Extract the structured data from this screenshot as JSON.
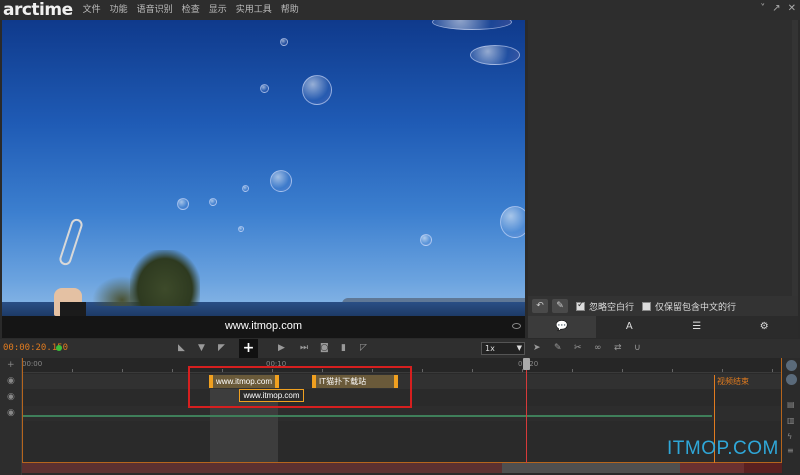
{
  "app": {
    "logo": "arctime",
    "window_controls": [
      "˅",
      "↗",
      "✕"
    ]
  },
  "menu": [
    "文件",
    "功能",
    "语音识别",
    "检查",
    "显示",
    "实用工具",
    "帮助"
  ],
  "caption": {
    "text": "www.itmop.com"
  },
  "right_toolbar": {
    "option1": "忽略空白行",
    "option1_checked": true,
    "option2": "仅保留包含中文的行",
    "option2_checked": false
  },
  "right_tabs": [
    "💬",
    "A",
    "☰",
    "⚙"
  ],
  "controls": {
    "timecode": "00:00:20.150",
    "plus_label": "+",
    "speed_value": "1x"
  },
  "timeline": {
    "ruler_labels": [
      "00:00",
      "00:10",
      "00:20"
    ],
    "blocks": [
      {
        "text": "www.itmop.com"
      },
      {
        "text": "IT猫扑下载站"
      }
    ],
    "selected_tooltip": "www.itmop.com",
    "end_marker": "视频结束"
  },
  "watermark": "ITMOP.COM",
  "colors": {
    "accent_orange": "#e07b1f",
    "highlight_red": "#d61f1f",
    "block_border": "#f0a020",
    "watermark_blue": "#2fa7d8"
  }
}
